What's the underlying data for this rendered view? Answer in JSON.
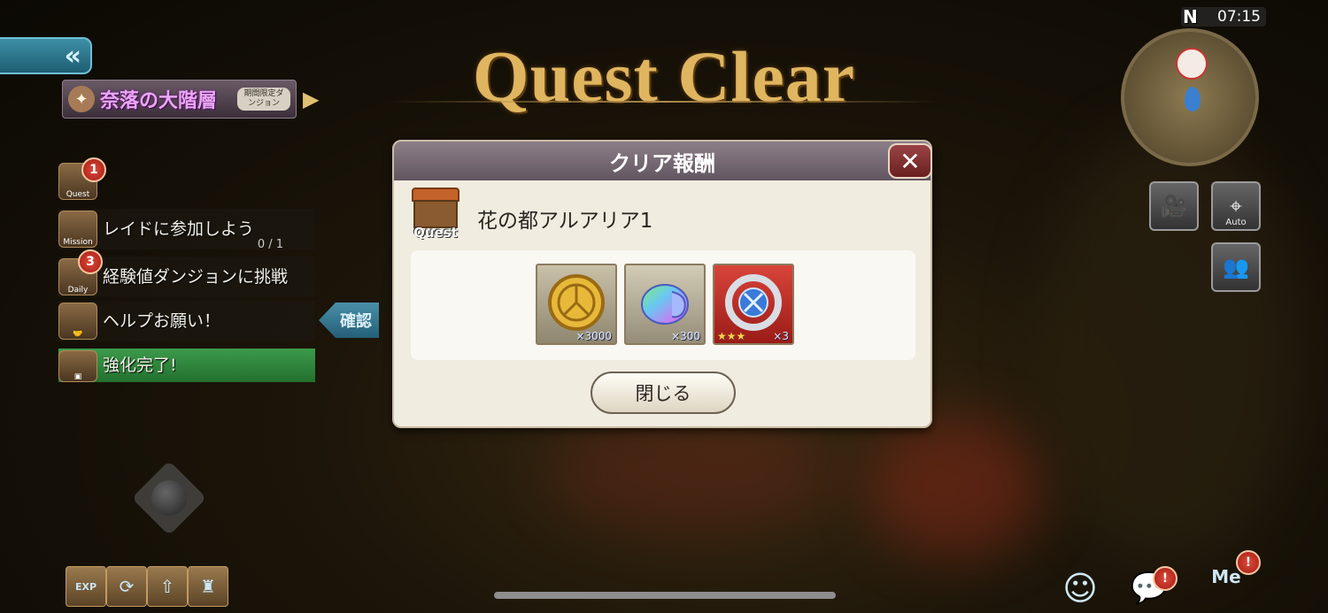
{
  "title": "Quest Clear",
  "status_bar": {
    "time": "07:15",
    "compass": "N"
  },
  "collapse_tab": {
    "label": "«"
  },
  "dungeon_banner": {
    "name": "奈落の大階層",
    "tag": "期間限定ダンジョン"
  },
  "quest_list": [
    {
      "icon_label": "Quest",
      "badge": "1",
      "text": "",
      "count": ""
    },
    {
      "icon_label": "Mission",
      "badge": "",
      "text": "レイドに参加しよう",
      "count": "0 / 1"
    },
    {
      "icon_label": "Daily",
      "badge": "3",
      "text": "経験値ダンジョンに挑戦",
      "count": ""
    },
    {
      "icon_label": "",
      "badge": "",
      "text": "ヘルプお願い！",
      "count": ""
    },
    {
      "icon_label": "",
      "badge": "",
      "text": "強化完了!",
      "count": ""
    }
  ],
  "confirm_button": "確認",
  "dialog": {
    "header": "クリア報酬",
    "close_x": "✕",
    "quest_icon_label": "Quest",
    "quest_name": "花の都アルアリア1",
    "rewards": [
      {
        "icon": "gold-coin-icon",
        "quantity": "×3000",
        "stars": ""
      },
      {
        "icon": "rainbow-slime-icon",
        "quantity": "×300",
        "stars": ""
      },
      {
        "icon": "blue-gem-ring-icon",
        "quantity": "×3",
        "stars": "★★★"
      }
    ],
    "close_button": "閉じる"
  },
  "side_buttons": {
    "camera_icon": "video-camera-icon",
    "auto_label": "Auto",
    "party_icon": "party-icon"
  },
  "skill_buttons": [
    {
      "icon": "exp-boost-icon",
      "label": "EXP"
    },
    {
      "icon": "rotate-icon",
      "label": ""
    },
    {
      "icon": "upgrade-icon",
      "label": ""
    },
    {
      "icon": "treasure-icon",
      "label": ""
    }
  ],
  "bottom_right": {
    "me_label": "Me"
  },
  "colors": {
    "title_gold": "#e0b560",
    "dialog_header": "#7a6d77",
    "close_red": "#8a3030",
    "tab_blue": "#2d7a92",
    "quest_green": "#2f8a3c"
  }
}
